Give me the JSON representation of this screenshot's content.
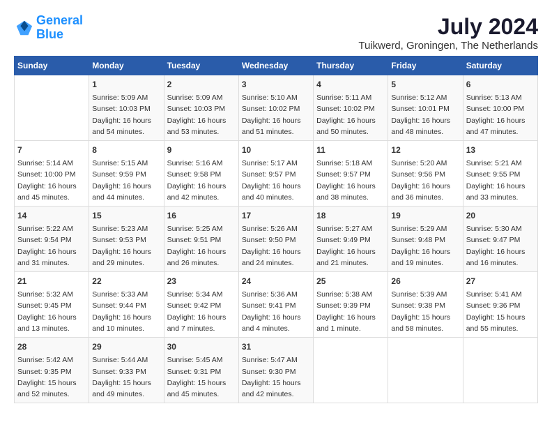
{
  "header": {
    "logo_line1": "General",
    "logo_line2": "Blue",
    "month_year": "July 2024",
    "location": "Tuikwerd, Groningen, The Netherlands"
  },
  "days_of_week": [
    "Sunday",
    "Monday",
    "Tuesday",
    "Wednesday",
    "Thursday",
    "Friday",
    "Saturday"
  ],
  "weeks": [
    [
      {
        "day": "",
        "content": ""
      },
      {
        "day": "1",
        "content": "Sunrise: 5:09 AM\nSunset: 10:03 PM\nDaylight: 16 hours\nand 54 minutes."
      },
      {
        "day": "2",
        "content": "Sunrise: 5:09 AM\nSunset: 10:03 PM\nDaylight: 16 hours\nand 53 minutes."
      },
      {
        "day": "3",
        "content": "Sunrise: 5:10 AM\nSunset: 10:02 PM\nDaylight: 16 hours\nand 51 minutes."
      },
      {
        "day": "4",
        "content": "Sunrise: 5:11 AM\nSunset: 10:02 PM\nDaylight: 16 hours\nand 50 minutes."
      },
      {
        "day": "5",
        "content": "Sunrise: 5:12 AM\nSunset: 10:01 PM\nDaylight: 16 hours\nand 48 minutes."
      },
      {
        "day": "6",
        "content": "Sunrise: 5:13 AM\nSunset: 10:00 PM\nDaylight: 16 hours\nand 47 minutes."
      }
    ],
    [
      {
        "day": "7",
        "content": "Sunrise: 5:14 AM\nSunset: 10:00 PM\nDaylight: 16 hours\nand 45 minutes."
      },
      {
        "day": "8",
        "content": "Sunrise: 5:15 AM\nSunset: 9:59 PM\nDaylight: 16 hours\nand 44 minutes."
      },
      {
        "day": "9",
        "content": "Sunrise: 5:16 AM\nSunset: 9:58 PM\nDaylight: 16 hours\nand 42 minutes."
      },
      {
        "day": "10",
        "content": "Sunrise: 5:17 AM\nSunset: 9:57 PM\nDaylight: 16 hours\nand 40 minutes."
      },
      {
        "day": "11",
        "content": "Sunrise: 5:18 AM\nSunset: 9:57 PM\nDaylight: 16 hours\nand 38 minutes."
      },
      {
        "day": "12",
        "content": "Sunrise: 5:20 AM\nSunset: 9:56 PM\nDaylight: 16 hours\nand 36 minutes."
      },
      {
        "day": "13",
        "content": "Sunrise: 5:21 AM\nSunset: 9:55 PM\nDaylight: 16 hours\nand 33 minutes."
      }
    ],
    [
      {
        "day": "14",
        "content": "Sunrise: 5:22 AM\nSunset: 9:54 PM\nDaylight: 16 hours\nand 31 minutes."
      },
      {
        "day": "15",
        "content": "Sunrise: 5:23 AM\nSunset: 9:53 PM\nDaylight: 16 hours\nand 29 minutes."
      },
      {
        "day": "16",
        "content": "Sunrise: 5:25 AM\nSunset: 9:51 PM\nDaylight: 16 hours\nand 26 minutes."
      },
      {
        "day": "17",
        "content": "Sunrise: 5:26 AM\nSunset: 9:50 PM\nDaylight: 16 hours\nand 24 minutes."
      },
      {
        "day": "18",
        "content": "Sunrise: 5:27 AM\nSunset: 9:49 PM\nDaylight: 16 hours\nand 21 minutes."
      },
      {
        "day": "19",
        "content": "Sunrise: 5:29 AM\nSunset: 9:48 PM\nDaylight: 16 hours\nand 19 minutes."
      },
      {
        "day": "20",
        "content": "Sunrise: 5:30 AM\nSunset: 9:47 PM\nDaylight: 16 hours\nand 16 minutes."
      }
    ],
    [
      {
        "day": "21",
        "content": "Sunrise: 5:32 AM\nSunset: 9:45 PM\nDaylight: 16 hours\nand 13 minutes."
      },
      {
        "day": "22",
        "content": "Sunrise: 5:33 AM\nSunset: 9:44 PM\nDaylight: 16 hours\nand 10 minutes."
      },
      {
        "day": "23",
        "content": "Sunrise: 5:34 AM\nSunset: 9:42 PM\nDaylight: 16 hours\nand 7 minutes."
      },
      {
        "day": "24",
        "content": "Sunrise: 5:36 AM\nSunset: 9:41 PM\nDaylight: 16 hours\nand 4 minutes."
      },
      {
        "day": "25",
        "content": "Sunrise: 5:38 AM\nSunset: 9:39 PM\nDaylight: 16 hours\nand 1 minute."
      },
      {
        "day": "26",
        "content": "Sunrise: 5:39 AM\nSunset: 9:38 PM\nDaylight: 15 hours\nand 58 minutes."
      },
      {
        "day": "27",
        "content": "Sunrise: 5:41 AM\nSunset: 9:36 PM\nDaylight: 15 hours\nand 55 minutes."
      }
    ],
    [
      {
        "day": "28",
        "content": "Sunrise: 5:42 AM\nSunset: 9:35 PM\nDaylight: 15 hours\nand 52 minutes."
      },
      {
        "day": "29",
        "content": "Sunrise: 5:44 AM\nSunset: 9:33 PM\nDaylight: 15 hours\nand 49 minutes."
      },
      {
        "day": "30",
        "content": "Sunrise: 5:45 AM\nSunset: 9:31 PM\nDaylight: 15 hours\nand 45 minutes."
      },
      {
        "day": "31",
        "content": "Sunrise: 5:47 AM\nSunset: 9:30 PM\nDaylight: 15 hours\nand 42 minutes."
      },
      {
        "day": "",
        "content": ""
      },
      {
        "day": "",
        "content": ""
      },
      {
        "day": "",
        "content": ""
      }
    ]
  ]
}
